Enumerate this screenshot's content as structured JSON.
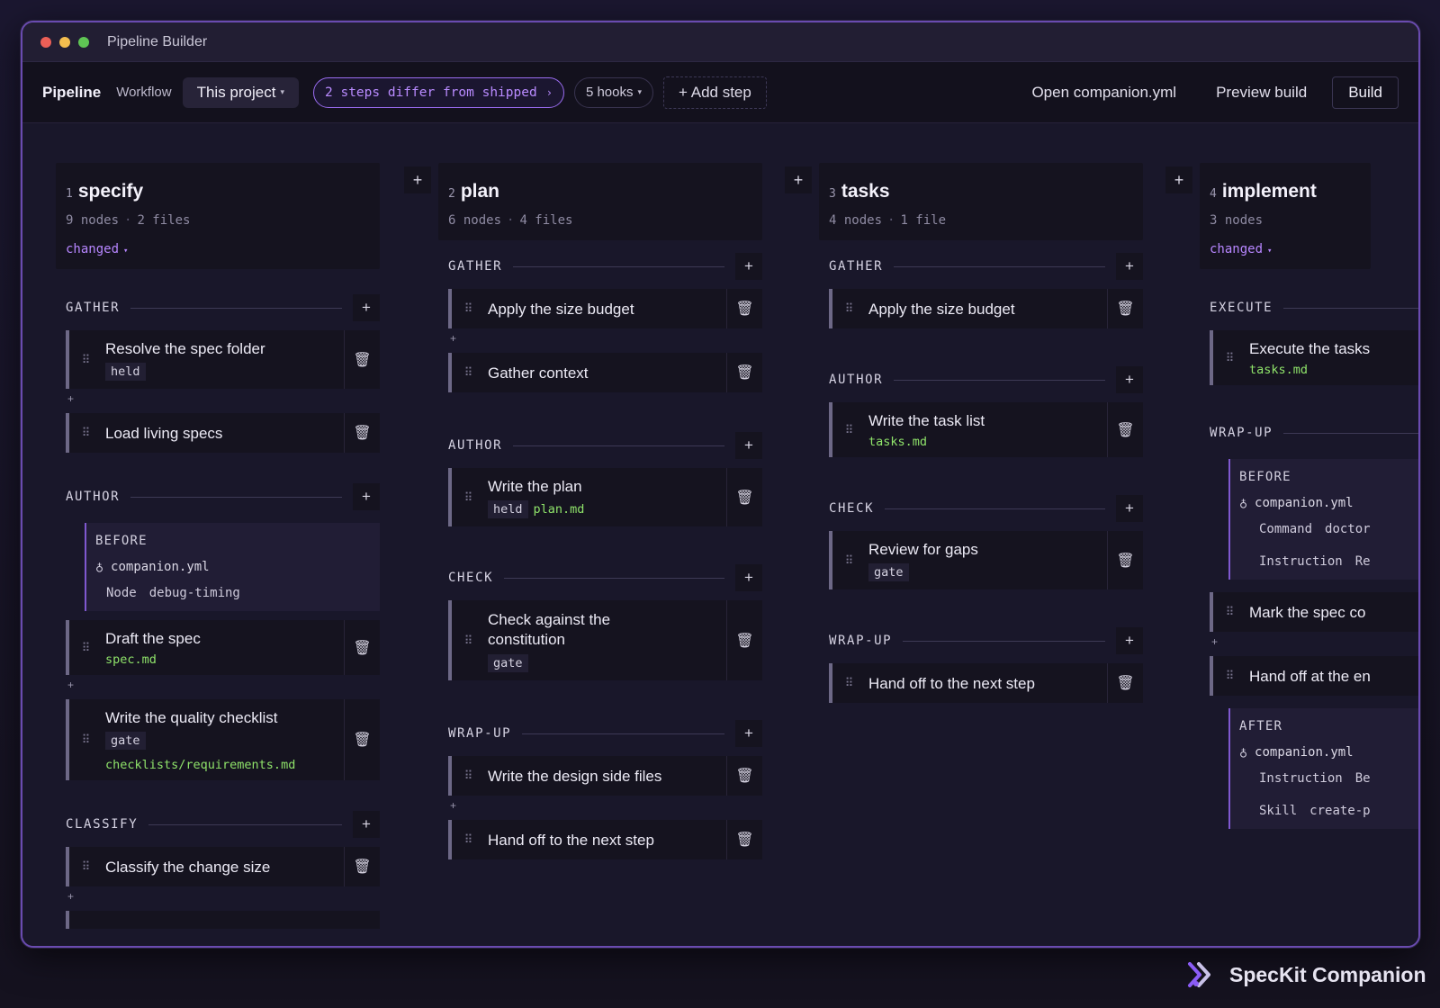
{
  "window": {
    "title": "Pipeline Builder"
  },
  "toolbar": {
    "title": "Pipeline",
    "tab": "Workflow",
    "scope": "This project",
    "diff_badge": "2 steps differ from shipped",
    "hooks": "5 hooks",
    "add_step": "+ Add step",
    "open_file": "Open companion.yml",
    "preview": "Preview build",
    "build": "Build"
  },
  "steps": [
    {
      "num": "1",
      "name": "specify",
      "nodes": "9 nodes",
      "files": "2 files",
      "changed": "changed",
      "groups": [
        {
          "label": "GATHER",
          "nodes": [
            {
              "title": "Resolve the spec folder",
              "tag": "held"
            },
            {
              "title": "Load living specs"
            }
          ]
        },
        {
          "label": "AUTHOR",
          "hook": {
            "label": "BEFORE",
            "file": "companion.yml",
            "k": "Node",
            "v": "debug-timing"
          },
          "nodes": [
            {
              "title": "Draft the spec",
              "file": "spec.md"
            },
            {
              "title": "Write the quality checklist",
              "tag": "gate",
              "file": "checklists/requirements.md"
            }
          ]
        },
        {
          "label": "CLASSIFY",
          "nodes": [
            {
              "title": "Classify the change size"
            }
          ]
        }
      ]
    },
    {
      "num": "2",
      "name": "plan",
      "nodes": "6 nodes",
      "files": "4 files",
      "groups": [
        {
          "label": "GATHER",
          "nodes": [
            {
              "title": "Apply the size budget"
            },
            {
              "title": "Gather context"
            }
          ]
        },
        {
          "label": "AUTHOR",
          "nodes": [
            {
              "title": "Write the plan",
              "tag": "held",
              "file": "plan.md"
            }
          ]
        },
        {
          "label": "CHECK",
          "nodes": [
            {
              "title": "Check against the constitution",
              "tag": "gate"
            }
          ]
        },
        {
          "label": "WRAP-UP",
          "nodes": [
            {
              "title": "Write the design side files"
            },
            {
              "title": "Hand off to the next step"
            }
          ]
        }
      ]
    },
    {
      "num": "3",
      "name": "tasks",
      "nodes": "4 nodes",
      "files": "1 file",
      "groups": [
        {
          "label": "GATHER",
          "nodes": [
            {
              "title": "Apply the size budget"
            }
          ]
        },
        {
          "label": "AUTHOR",
          "nodes": [
            {
              "title": "Write the task list",
              "file": "tasks.md"
            }
          ]
        },
        {
          "label": "CHECK",
          "nodes": [
            {
              "title": "Review for gaps",
              "tag": "gate"
            }
          ]
        },
        {
          "label": "WRAP-UP",
          "nodes": [
            {
              "title": "Hand off to the next step"
            }
          ]
        }
      ]
    },
    {
      "num": "4",
      "name": "implement",
      "nodes": "3 nodes",
      "changed": "changed",
      "groups": [
        {
          "label": "EXECUTE",
          "nodes": [
            {
              "title": "Execute the tasks",
              "file": "tasks.md"
            }
          ]
        },
        {
          "label": "WRAP-UP",
          "hook": {
            "label": "BEFORE",
            "file": "companion.yml",
            "rows": [
              [
                "Command",
                "doctor"
              ],
              [
                "Instruction",
                "Re"
              ]
            ]
          },
          "nodes": [
            {
              "title": "Mark the spec co"
            },
            {
              "title": "Hand off at the en"
            }
          ],
          "after": {
            "label": "AFTER",
            "file": "companion.yml",
            "rows": [
              [
                "Instruction",
                "Be"
              ],
              [
                "Skill",
                "create-p"
              ]
            ]
          }
        }
      ]
    }
  ],
  "brand": {
    "name": "SpecKit Companion",
    "color": "#8b5cf6"
  },
  "colors": {
    "accent": "#9a6cf0",
    "file": "#8fe36a",
    "border": "#6a4bb0"
  }
}
